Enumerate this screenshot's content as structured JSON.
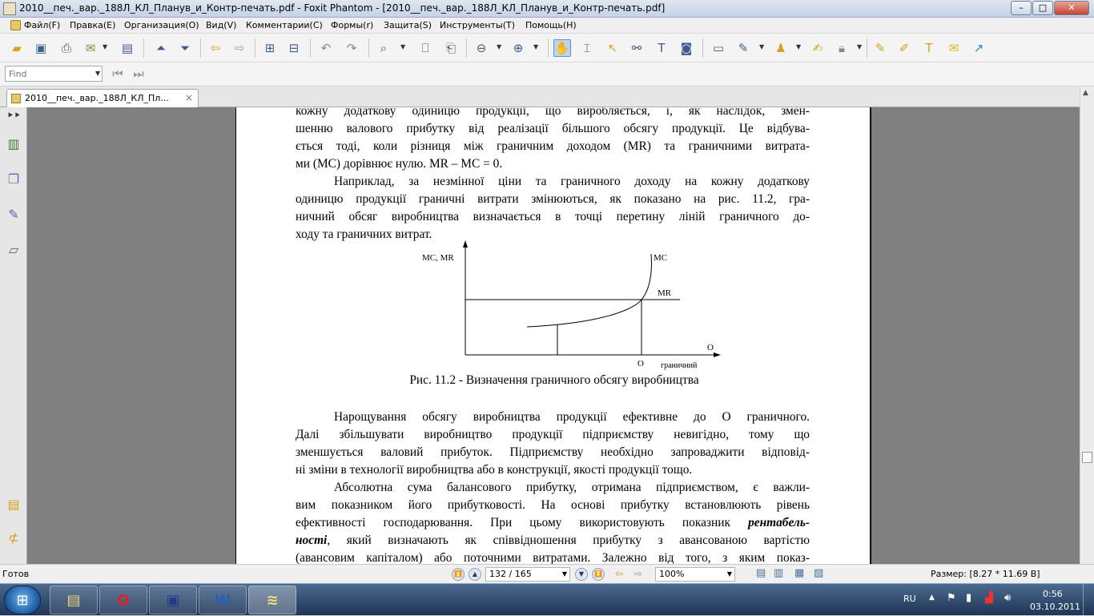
{
  "window": {
    "title": "2010__печ._вар._188Л_КЛ_Планув_и_Контр-печать.pdf - Foxit Phantom - [2010__печ._вар._188Л_КЛ_Планув_и_Контр-печать.pdf]",
    "minimize": "–",
    "maximize": "□",
    "close": "✕"
  },
  "menu": [
    "Файл(F)",
    "Правка(E)",
    "Организация(O)",
    "Вид(V)",
    "Комментарии(C)",
    "Формы(r)",
    "Защита(S)",
    "Инструменты(T)",
    "Помощь(H)"
  ],
  "find": {
    "placeholder": "Find"
  },
  "tab": {
    "label": "2010__печ._вар._188Л_КЛ_Пл...",
    "close": "×"
  },
  "document": {
    "lines": [
      {
        "text": "кожну додаткову одиницю продукції, що виробляється, і, як наслідок, змен-",
        "indent": false,
        "justify": true
      },
      {
        "text": "шенню валового прибутку від реалізації більшого обсягу продукції. Це відбува-",
        "indent": false,
        "justify": true
      },
      {
        "text": "ється тоді, коли різниця між граничним доходом (MR) та граничними витрата-",
        "indent": false,
        "justify": true
      },
      {
        "text": "ми (MC) дорівнює нулю. MR – MC = 0.",
        "indent": false,
        "justify": false
      },
      {
        "text": "Наприклад, за незмінної ціни та граничного доходу на кожну додаткову",
        "indent": true,
        "justify": true
      },
      {
        "text": "одиницю продукції граничні витрати змінюються, як показано на рис. 11.2, гра-",
        "indent": false,
        "justify": true
      },
      {
        "text": "ничний обсяг виробництва визначається в точці перетину ліній граничного до-",
        "indent": false,
        "justify": true
      },
      {
        "text": "ходу та граничних витрат.",
        "indent": false,
        "justify": false
      }
    ],
    "figure_caption": "Рис. 11.2 - Визначення граничного обсягу виробництва",
    "lines_after": [
      {
        "text": "Нарощування обсягу виробництва продукції ефективне до O граничного.",
        "indent": true,
        "justify": true
      },
      {
        "text": "Далі збільшувати виробництво продукції підприємству невигідно, тому що",
        "indent": false,
        "justify": true
      },
      {
        "text": "зменшується валовий прибуток. Підприємству необхідно запроваджити відповід-",
        "indent": false,
        "justify": true
      },
      {
        "text": "ні зміни в технології виробництва або в конструкції, якості продукції тощо.",
        "indent": false,
        "justify": false
      },
      {
        "text": "Абсолютна сума балансового прибутку, отримана підприємством, є важли-",
        "indent": true,
        "justify": true
      },
      {
        "text": "вим показником його прибутковості. На основі прибутку встановлюють рівень",
        "indent": false,
        "justify": true
      },
      {
        "text": "ефективності господарювання. При цьому використовують показник",
        "indent": false,
        "justify": true,
        "em": "рентабель-"
      },
      {
        "text": ", який визначають як співвідношення прибутку з авансованою вартістю",
        "indent": false,
        "justify": true,
        "em_before": "ності"
      },
      {
        "text": "(авансовим капіталом) або поточними витратами. Залежно від того, з яким показ-",
        "indent": false,
        "justify": true
      }
    ]
  },
  "chart_data": {
    "type": "line",
    "ylabel": "MC, MR",
    "xlabel": "O граничний",
    "xlabel_top": "O",
    "xlabel_bottom": "граничний",
    "tick_label": "O",
    "series": [
      {
        "name": "MC",
        "shape": "rising convex curve"
      },
      {
        "name": "MR",
        "shape": "horizontal line"
      }
    ],
    "grid": false
  },
  "status": {
    "ready": "Готов",
    "page": "132 / 165",
    "zoom": "100%",
    "size": "Размер: [8.27 * 11.69 В]"
  },
  "taskbar": {
    "lang": "RU",
    "time": "0:56",
    "date": "03.10.2011",
    "start_glyph": "⊞",
    "apps": [
      {
        "name": "explorer",
        "glyph": "▤"
      },
      {
        "name": "opera",
        "glyph": "O"
      },
      {
        "name": "save",
        "glyph": "▣"
      },
      {
        "name": "word",
        "glyph": "W"
      },
      {
        "name": "foxit",
        "glyph": "≋"
      }
    ]
  }
}
